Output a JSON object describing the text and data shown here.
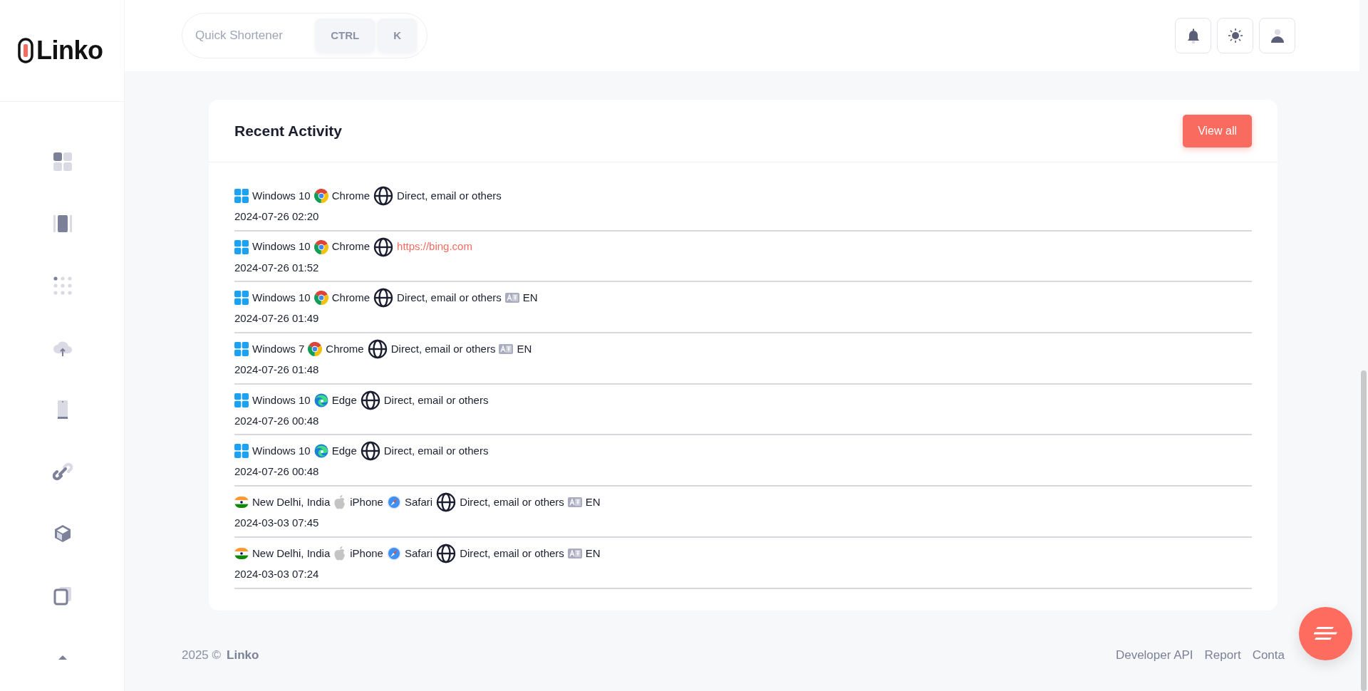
{
  "logo": {
    "text": "Linko"
  },
  "search": {
    "placeholder": "Quick Shortener",
    "keys": [
      "CTRL",
      "K"
    ]
  },
  "activity": {
    "title": "Recent Activity",
    "view_all": "View all",
    "rows": [
      {
        "items": [
          {
            "kind": "windows",
            "text": "Windows 10"
          },
          {
            "kind": "chrome",
            "text": "Chrome"
          },
          {
            "kind": "referrer",
            "text": "Direct, email or others"
          }
        ],
        "time": "2024-07-26 02:20"
      },
      {
        "items": [
          {
            "kind": "windows",
            "text": "Windows 10"
          },
          {
            "kind": "chrome",
            "text": "Chrome"
          },
          {
            "kind": "link",
            "text": "https://bing.com"
          }
        ],
        "time": "2024-07-26 01:52"
      },
      {
        "items": [
          {
            "kind": "windows",
            "text": "Windows 10"
          },
          {
            "kind": "chrome",
            "text": "Chrome"
          },
          {
            "kind": "referrer",
            "text": "Direct, email or others"
          },
          {
            "kind": "language",
            "text": "EN"
          }
        ],
        "time": "2024-07-26 01:49"
      },
      {
        "items": [
          {
            "kind": "windows",
            "text": "Windows 7"
          },
          {
            "kind": "chrome",
            "text": "Chrome"
          },
          {
            "kind": "referrer",
            "text": "Direct, email or others"
          },
          {
            "kind": "language",
            "text": "EN"
          }
        ],
        "time": "2024-07-26 01:48"
      },
      {
        "items": [
          {
            "kind": "windows",
            "text": "Windows 10"
          },
          {
            "kind": "edge",
            "text": "Edge"
          },
          {
            "kind": "referrer",
            "text": "Direct, email or others"
          }
        ],
        "time": "2024-07-26 00:48"
      },
      {
        "items": [
          {
            "kind": "windows",
            "text": "Windows 10"
          },
          {
            "kind": "edge",
            "text": "Edge"
          },
          {
            "kind": "referrer",
            "text": "Direct, email or others"
          }
        ],
        "time": "2024-07-26 00:48"
      },
      {
        "items": [
          {
            "kind": "flag",
            "text": "New Delhi, India"
          },
          {
            "kind": "apple",
            "text": "iPhone"
          },
          {
            "kind": "safari",
            "text": "Safari"
          },
          {
            "kind": "referrer",
            "text": "Direct, email or others"
          },
          {
            "kind": "language",
            "text": "EN"
          }
        ],
        "time": "2024-03-03 07:45"
      },
      {
        "items": [
          {
            "kind": "flag",
            "text": "New Delhi, India"
          },
          {
            "kind": "apple",
            "text": "iPhone"
          },
          {
            "kind": "safari",
            "text": "Safari"
          },
          {
            "kind": "referrer",
            "text": "Direct, email or others"
          },
          {
            "kind": "language",
            "text": "EN"
          }
        ],
        "time": "2024-03-03 07:24"
      }
    ]
  },
  "footer": {
    "year": "2025 ©",
    "brand": "Linko",
    "links": [
      "Developer API",
      "Report",
      "Conta"
    ]
  }
}
